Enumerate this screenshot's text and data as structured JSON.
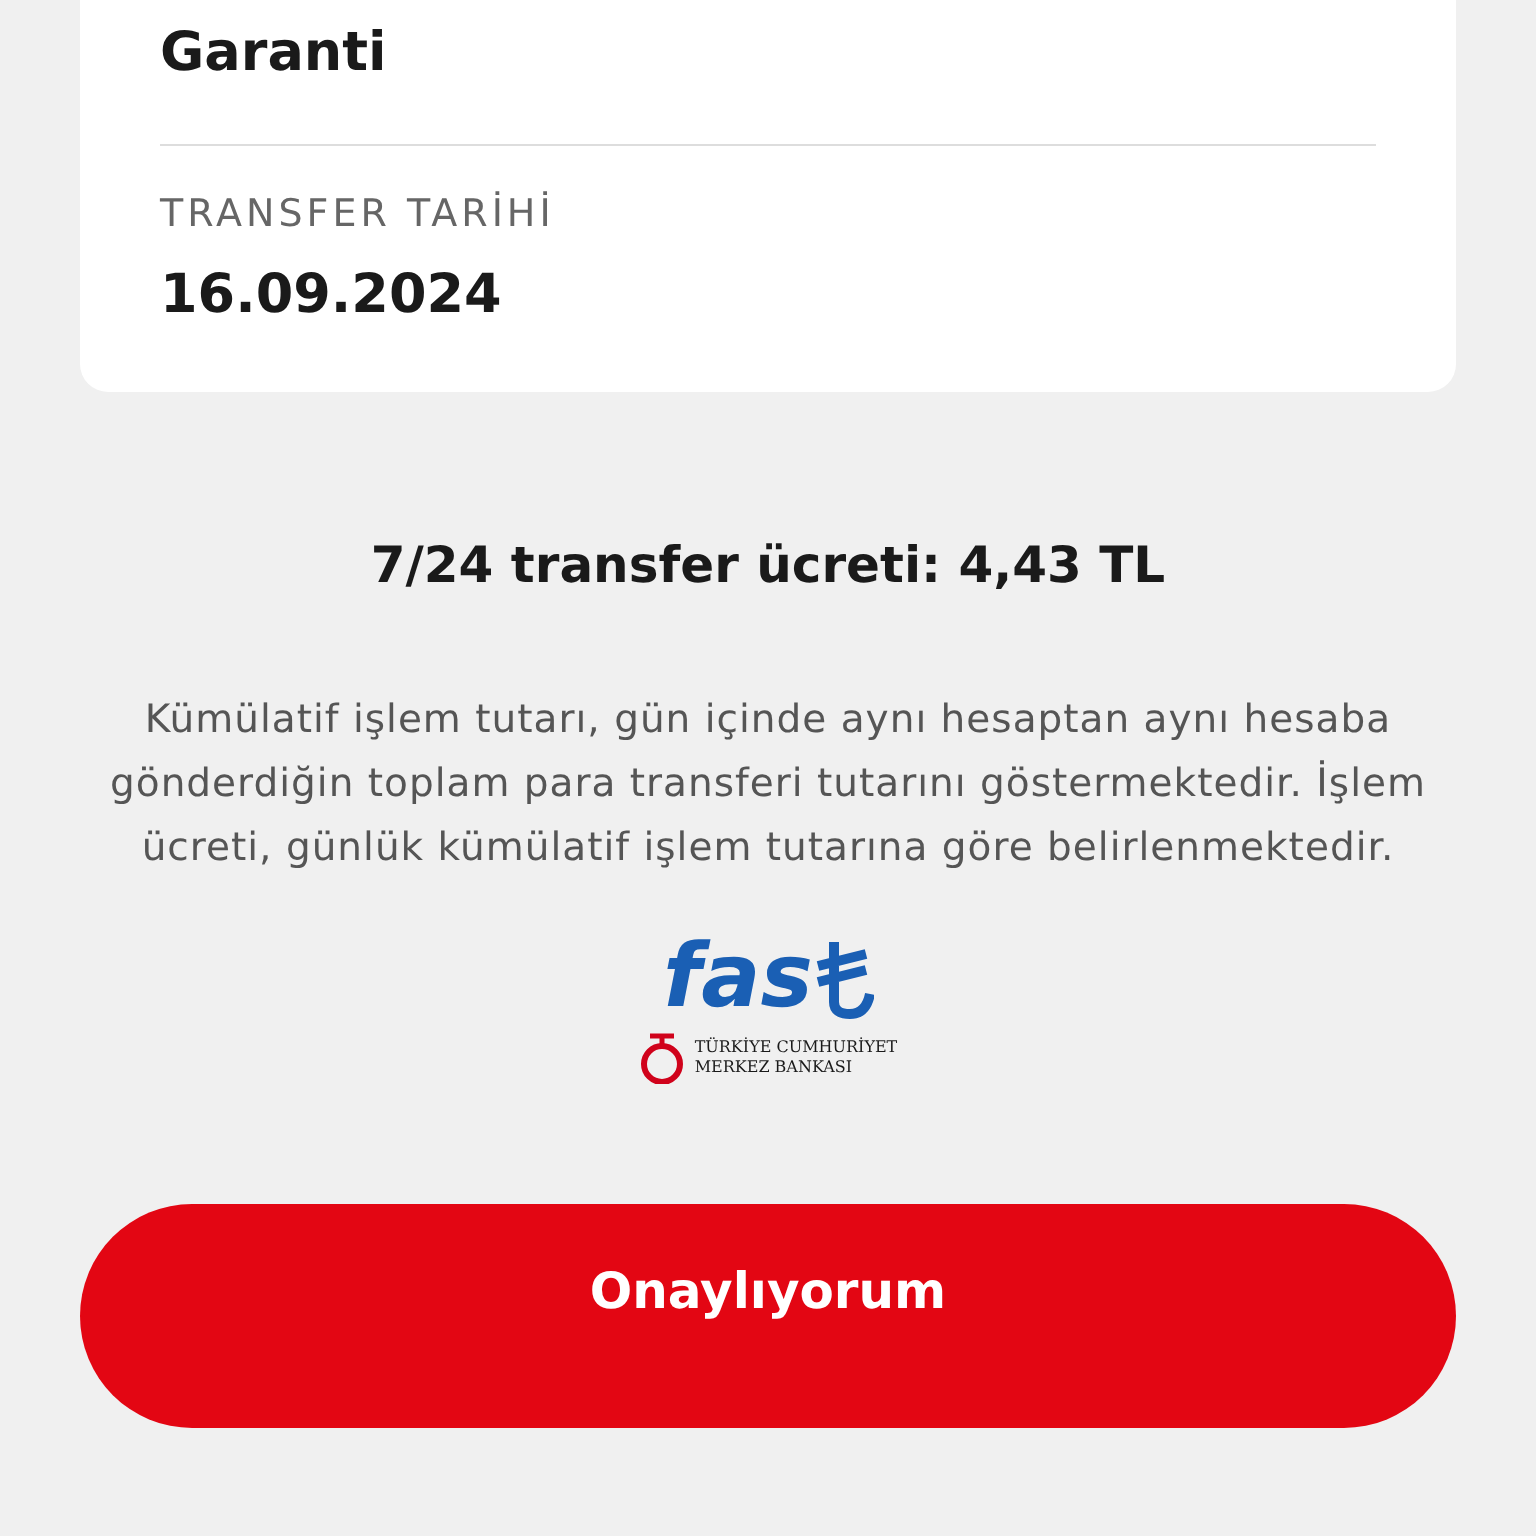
{
  "recipient": {
    "bank": "Garanti"
  },
  "transfer_date": {
    "label": "TRANSFER TARİHİ",
    "value": "16.09.2024"
  },
  "fee": "7/24 transfer ücreti: 4,43 TL",
  "note": "Kümülatif işlem tutarı, gün içinde aynı hesaptan aynı hesaba gönderdiğin toplam para transferi tutarını göstermektedir. İşlem ücreti, günlük kümülatif işlem tutarına göre belirlenmektedir.",
  "logo": {
    "wordmark": "fas",
    "issuer_lines": [
      "TÜRKİYE CUMHURİYET",
      "MERKEZ BANKASI"
    ]
  },
  "confirm_button": "Onaylıyorum"
}
